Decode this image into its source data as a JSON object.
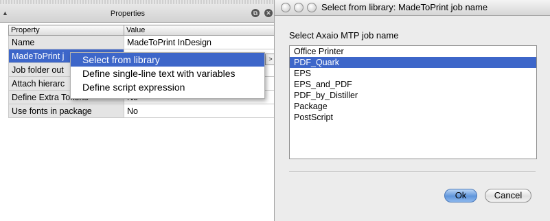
{
  "properties_panel": {
    "title": "Properties",
    "columns": {
      "property": "Property",
      "value": "Value"
    },
    "rows": [
      {
        "key": "Name",
        "value": "MadeToPrint InDesign"
      },
      {
        "key": "MadeToPrint j",
        "value": ""
      },
      {
        "key": "Job folder out",
        "value": ""
      },
      {
        "key": "Attach hierarc",
        "value": ""
      },
      {
        "key": "Define Extra Tokens",
        "value": "No"
      },
      {
        "key": "Use fonts in package",
        "value": "No"
      }
    ],
    "more_button_glyph": ">"
  },
  "context_menu": {
    "items": [
      "Select from library",
      "Define single-line text with variables",
      "Define script expression"
    ],
    "highlighted_index": 0
  },
  "dialog": {
    "title": "Select from library: MadeToPrint job name",
    "prompt": "Select Axaio MTP job name",
    "items": [
      "Office Printer",
      "PDF_Quark",
      "EPS",
      "EPS_and_PDF",
      "PDF_by_Distiller",
      "Package",
      "PostScript"
    ],
    "selected_index": 1,
    "ok_label": "Ok",
    "cancel_label": "Cancel"
  },
  "colors": {
    "selection": "#3d66c9",
    "dialog_background": "#ececec"
  }
}
